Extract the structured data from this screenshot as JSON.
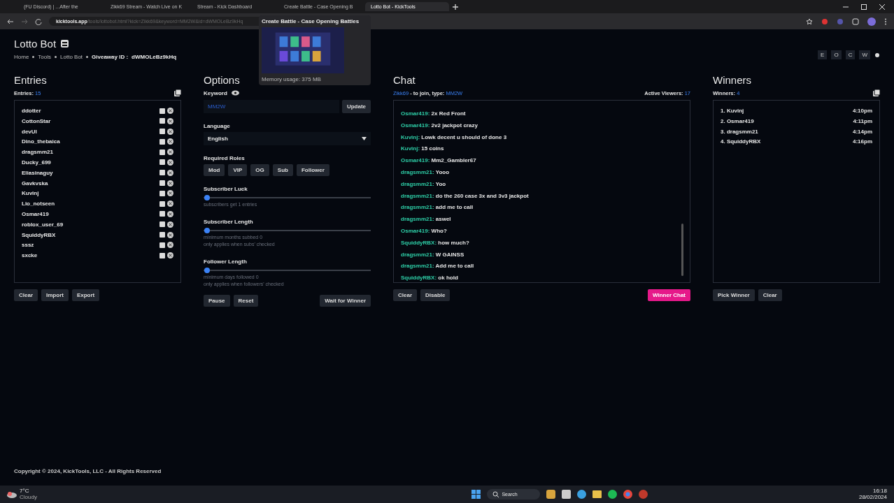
{
  "browser": {
    "tabs": [
      {
        "title": "(FU Discord) | ...After the",
        "selected": false
      },
      {
        "title": "Zikk69 Stream - Watch Live on K",
        "selected": false
      },
      {
        "title": "Stream - Kick Dashboard",
        "selected": false
      },
      {
        "title": "Create Battle - Case Opening B",
        "selected": false
      },
      {
        "title": "Lotto Bot - KickTools",
        "selected": true
      }
    ],
    "address": {
      "host": "kicktools.app",
      "path": "/tools/lottobot.html?kick=Zikk69&keyword=MM2W&id=dWMOLeBz9kHq"
    },
    "tab_preview": {
      "title": "Create Battle - Case Opening Battles",
      "memory": "Memory usage: 375 MB"
    }
  },
  "page": {
    "title": "Lotto Bot",
    "breadcrumbs": [
      "Home",
      "Tools",
      "Lotto Bot"
    ],
    "giveaway_label": "Giveaway ID :",
    "giveaway_id": "dWMOLeBz9kHq",
    "letter_buttons": [
      "E",
      "O",
      "C",
      "W"
    ]
  },
  "entries": {
    "heading": "Entries",
    "count_label": "Entries:",
    "count": "15",
    "items": [
      "ddotter",
      "CottonStar",
      "devUI",
      "Dino_thebaica",
      "dragsmm21",
      "Ducky_699",
      "Eliasinaguy",
      "Gavkvska",
      "Kuvinj",
      "Lio_notseen",
      "Osmar419",
      "roblox_user_69",
      "SquiddyRBX",
      "sssz",
      "sxcke"
    ],
    "buttons": [
      "Clear",
      "Import",
      "Export"
    ]
  },
  "options": {
    "heading": "Options",
    "keyword_label": "Keyword",
    "keyword": "MM2W",
    "update": "Update",
    "language_label": "Language",
    "language": "English",
    "roles_label": "Required Roles",
    "roles": [
      "Mod",
      "VIP",
      "OG",
      "Sub",
      "Follower"
    ],
    "sliders": [
      {
        "label": "Subscriber Luck",
        "level": 0.02,
        "notes": [
          "subscribers get 1 entries"
        ]
      },
      {
        "label": "Subscriber Length",
        "level": 0.02,
        "notes": [
          "minimum months subbed 0",
          "only applies when subs' checked"
        ]
      },
      {
        "label": "Follower Length",
        "level": 0.02,
        "notes": [
          "minimum days followed 0",
          "only applies when followers' checked"
        ]
      }
    ],
    "buttons": [
      "Pause",
      "Reset"
    ],
    "wait": "Wait for Winner"
  },
  "chat": {
    "heading": "Chat",
    "channel": "Zikk69",
    "join_text": "- to join, type:",
    "keyword": "MM2W",
    "viewers_label": "Active Viewers:",
    "viewers": "17",
    "messages": [
      {
        "user": "Osmar419:",
        "text": "2x Red Front"
      },
      {
        "user": "Osmar419:",
        "text": "2v2 jackpot crazy"
      },
      {
        "user": "Kuvinj:",
        "text": "Lowk decent u should of done 3"
      },
      {
        "user": "Kuvinj:",
        "text": "15 coins"
      },
      {
        "user": "Osmar419:",
        "text": "Mm2_Gambler67"
      },
      {
        "user": "dragsmm21:",
        "text": "Yooo"
      },
      {
        "user": "dragsmm21:",
        "text": "Yoo"
      },
      {
        "user": "dragsmm21:",
        "text": "do the 260 case 3x and 3v3 jackpot"
      },
      {
        "user": "dragsmm21:",
        "text": "add me to call"
      },
      {
        "user": "dragsmm21:",
        "text": "aswel"
      },
      {
        "user": "Osmar419:",
        "text": "Who?"
      },
      {
        "user": "SquiddyRBX:",
        "text": "how much?"
      },
      {
        "user": "dragsmm21:",
        "text": "W GAINSS"
      },
      {
        "user": "dragsmm21:",
        "text": "Add me to call"
      },
      {
        "user": "SquiddyRBX:",
        "text": "ok hold"
      }
    ],
    "buttons": [
      "Clear",
      "Disable"
    ],
    "winner_chat": "Winner Chat"
  },
  "winners": {
    "heading": "Winners",
    "count_label": "Winners:",
    "count": "4",
    "items": [
      {
        "rank": "1.",
        "name": "Kuvinj",
        "time": "4:10pm"
      },
      {
        "rank": "2.",
        "name": "Osmar419",
        "time": "4:11pm"
      },
      {
        "rank": "3.",
        "name": "dragsmm21",
        "time": "4:14pm"
      },
      {
        "rank": "4.",
        "name": "SquiddyRBX",
        "time": "4:16pm"
      }
    ],
    "buttons": [
      "Pick Winner",
      "Clear"
    ]
  },
  "footer": "Copyright © 2024, KickTools, LLC - All Rights Reserved",
  "taskbar": {
    "weather": "7°C",
    "weather_note": "Cloudy",
    "search": "Search",
    "time": "16:18",
    "date": "28/02/2024"
  }
}
